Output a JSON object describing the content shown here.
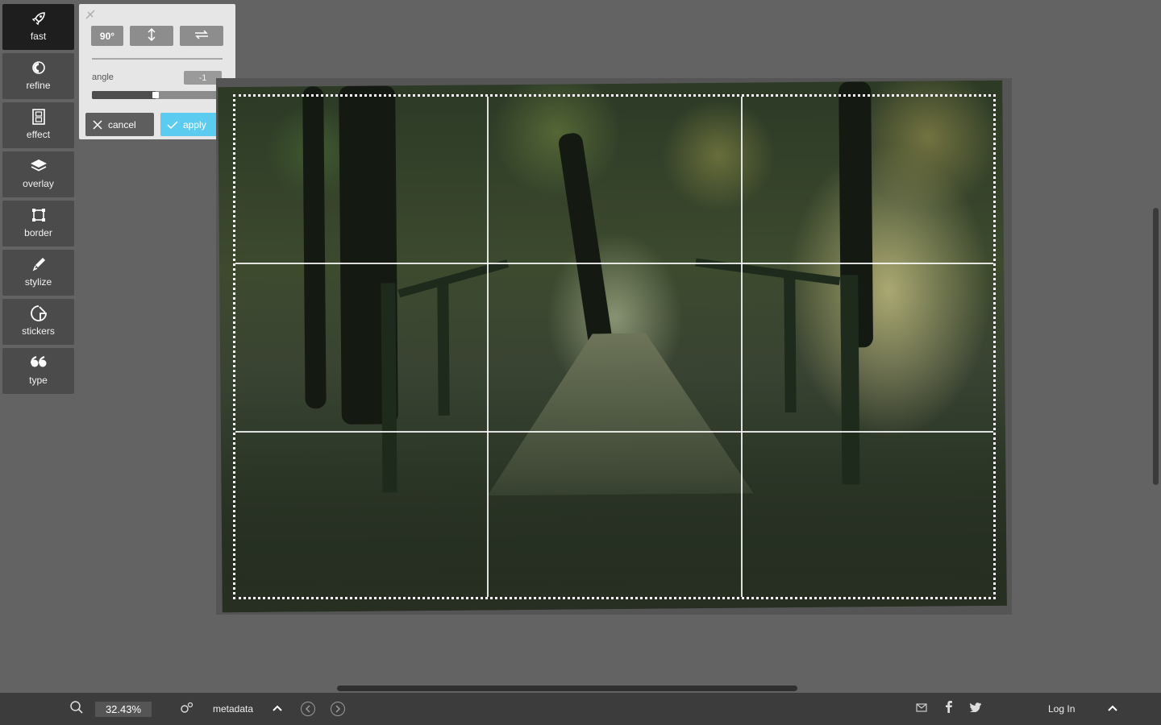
{
  "toolbar": {
    "items": [
      {
        "label": "fast",
        "icon": "rocket-icon"
      },
      {
        "label": "refine",
        "icon": "refine-icon"
      },
      {
        "label": "effect",
        "icon": "film-icon"
      },
      {
        "label": "overlay",
        "icon": "layers-icon"
      },
      {
        "label": "border",
        "icon": "border-icon"
      },
      {
        "label": "stylize",
        "icon": "brush-icon"
      },
      {
        "label": "stickers",
        "icon": "sticker-icon"
      },
      {
        "label": "type",
        "icon": "quote-icon"
      }
    ],
    "active": "fast"
  },
  "rotate_panel": {
    "rotate_90_label": "90°",
    "flip_vertical_icon": "flip-vertical-icon",
    "flip_horizontal_icon": "flip-horizontal-icon",
    "angle_label": "angle",
    "angle_value": "-1",
    "slider_fraction": 0.49,
    "cancel_label": "cancel",
    "apply_label": "apply"
  },
  "footer": {
    "zoom_value": "32.43%",
    "metadata_label": "metadata",
    "login_label": "Log In"
  },
  "colors": {
    "accent": "#5bcbef",
    "background": "#636363",
    "toolbar_active": "#1e1e1e"
  }
}
